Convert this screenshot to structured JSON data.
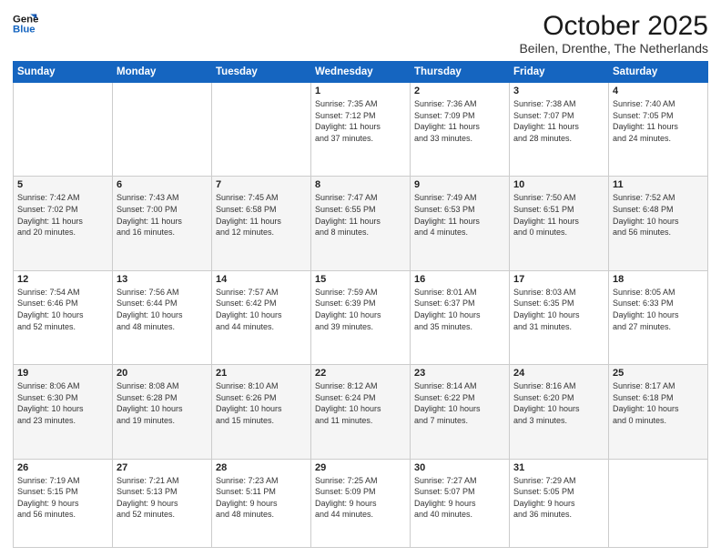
{
  "header": {
    "logo_line1": "General",
    "logo_line2": "Blue",
    "month": "October 2025",
    "location": "Beilen, Drenthe, The Netherlands"
  },
  "days_of_week": [
    "Sunday",
    "Monday",
    "Tuesday",
    "Wednesday",
    "Thursday",
    "Friday",
    "Saturday"
  ],
  "weeks": [
    [
      {
        "day": "",
        "content": ""
      },
      {
        "day": "",
        "content": ""
      },
      {
        "day": "",
        "content": ""
      },
      {
        "day": "1",
        "content": "Sunrise: 7:35 AM\nSunset: 7:12 PM\nDaylight: 11 hours\nand 37 minutes."
      },
      {
        "day": "2",
        "content": "Sunrise: 7:36 AM\nSunset: 7:09 PM\nDaylight: 11 hours\nand 33 minutes."
      },
      {
        "day": "3",
        "content": "Sunrise: 7:38 AM\nSunset: 7:07 PM\nDaylight: 11 hours\nand 28 minutes."
      },
      {
        "day": "4",
        "content": "Sunrise: 7:40 AM\nSunset: 7:05 PM\nDaylight: 11 hours\nand 24 minutes."
      }
    ],
    [
      {
        "day": "5",
        "content": "Sunrise: 7:42 AM\nSunset: 7:02 PM\nDaylight: 11 hours\nand 20 minutes."
      },
      {
        "day": "6",
        "content": "Sunrise: 7:43 AM\nSunset: 7:00 PM\nDaylight: 11 hours\nand 16 minutes."
      },
      {
        "day": "7",
        "content": "Sunrise: 7:45 AM\nSunset: 6:58 PM\nDaylight: 11 hours\nand 12 minutes."
      },
      {
        "day": "8",
        "content": "Sunrise: 7:47 AM\nSunset: 6:55 PM\nDaylight: 11 hours\nand 8 minutes."
      },
      {
        "day": "9",
        "content": "Sunrise: 7:49 AM\nSunset: 6:53 PM\nDaylight: 11 hours\nand 4 minutes."
      },
      {
        "day": "10",
        "content": "Sunrise: 7:50 AM\nSunset: 6:51 PM\nDaylight: 11 hours\nand 0 minutes."
      },
      {
        "day": "11",
        "content": "Sunrise: 7:52 AM\nSunset: 6:48 PM\nDaylight: 10 hours\nand 56 minutes."
      }
    ],
    [
      {
        "day": "12",
        "content": "Sunrise: 7:54 AM\nSunset: 6:46 PM\nDaylight: 10 hours\nand 52 minutes."
      },
      {
        "day": "13",
        "content": "Sunrise: 7:56 AM\nSunset: 6:44 PM\nDaylight: 10 hours\nand 48 minutes."
      },
      {
        "day": "14",
        "content": "Sunrise: 7:57 AM\nSunset: 6:42 PM\nDaylight: 10 hours\nand 44 minutes."
      },
      {
        "day": "15",
        "content": "Sunrise: 7:59 AM\nSunset: 6:39 PM\nDaylight: 10 hours\nand 39 minutes."
      },
      {
        "day": "16",
        "content": "Sunrise: 8:01 AM\nSunset: 6:37 PM\nDaylight: 10 hours\nand 35 minutes."
      },
      {
        "day": "17",
        "content": "Sunrise: 8:03 AM\nSunset: 6:35 PM\nDaylight: 10 hours\nand 31 minutes."
      },
      {
        "day": "18",
        "content": "Sunrise: 8:05 AM\nSunset: 6:33 PM\nDaylight: 10 hours\nand 27 minutes."
      }
    ],
    [
      {
        "day": "19",
        "content": "Sunrise: 8:06 AM\nSunset: 6:30 PM\nDaylight: 10 hours\nand 23 minutes."
      },
      {
        "day": "20",
        "content": "Sunrise: 8:08 AM\nSunset: 6:28 PM\nDaylight: 10 hours\nand 19 minutes."
      },
      {
        "day": "21",
        "content": "Sunrise: 8:10 AM\nSunset: 6:26 PM\nDaylight: 10 hours\nand 15 minutes."
      },
      {
        "day": "22",
        "content": "Sunrise: 8:12 AM\nSunset: 6:24 PM\nDaylight: 10 hours\nand 11 minutes."
      },
      {
        "day": "23",
        "content": "Sunrise: 8:14 AM\nSunset: 6:22 PM\nDaylight: 10 hours\nand 7 minutes."
      },
      {
        "day": "24",
        "content": "Sunrise: 8:16 AM\nSunset: 6:20 PM\nDaylight: 10 hours\nand 3 minutes."
      },
      {
        "day": "25",
        "content": "Sunrise: 8:17 AM\nSunset: 6:18 PM\nDaylight: 10 hours\nand 0 minutes."
      }
    ],
    [
      {
        "day": "26",
        "content": "Sunrise: 7:19 AM\nSunset: 5:15 PM\nDaylight: 9 hours\nand 56 minutes."
      },
      {
        "day": "27",
        "content": "Sunrise: 7:21 AM\nSunset: 5:13 PM\nDaylight: 9 hours\nand 52 minutes."
      },
      {
        "day": "28",
        "content": "Sunrise: 7:23 AM\nSunset: 5:11 PM\nDaylight: 9 hours\nand 48 minutes."
      },
      {
        "day": "29",
        "content": "Sunrise: 7:25 AM\nSunset: 5:09 PM\nDaylight: 9 hours\nand 44 minutes."
      },
      {
        "day": "30",
        "content": "Sunrise: 7:27 AM\nSunset: 5:07 PM\nDaylight: 9 hours\nand 40 minutes."
      },
      {
        "day": "31",
        "content": "Sunrise: 7:29 AM\nSunset: 5:05 PM\nDaylight: 9 hours\nand 36 minutes."
      },
      {
        "day": "",
        "content": ""
      }
    ]
  ]
}
